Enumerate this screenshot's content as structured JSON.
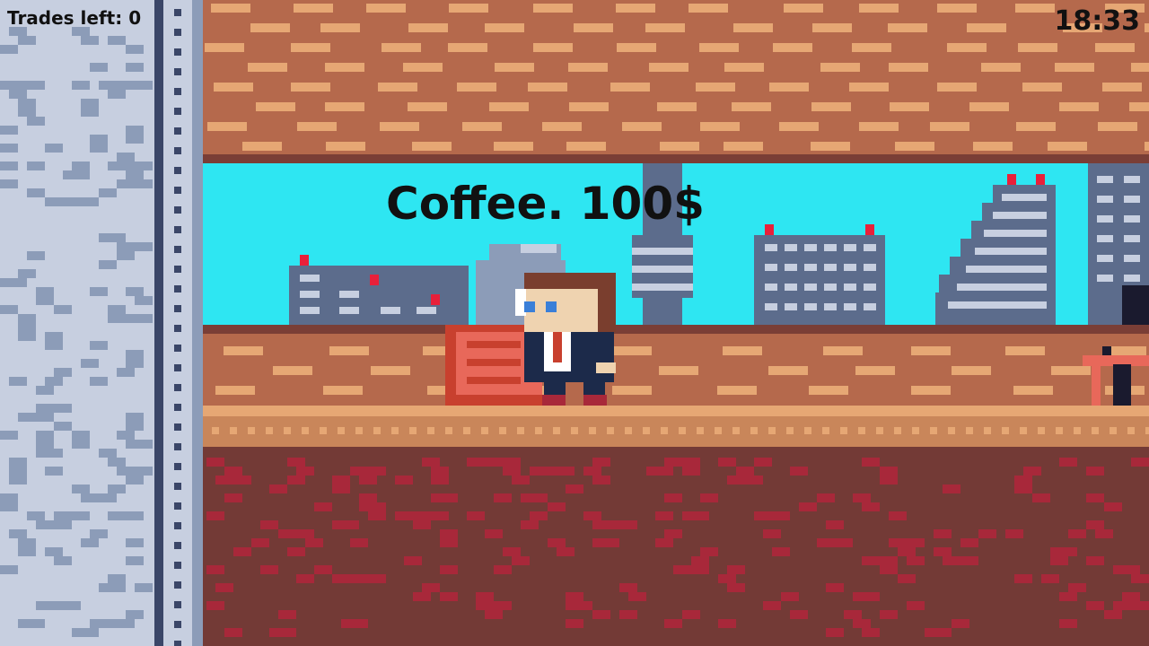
{
  "hud": {
    "trades_left": "Trades left: 0",
    "clock": "18:33"
  },
  "shop": {
    "price_label": "Coffee. 100$"
  },
  "colors": {
    "ceiling": "#b5694c",
    "ceiling_brick": "#e6a774",
    "sky": "#2ee6f2",
    "building": "#5c6c8c",
    "building_window": "#c7cfe0",
    "floor": "#e6a774",
    "ground": "#733a36",
    "ground_speck": "#a8283a",
    "wall_left": "#c7cfe0",
    "wall_speck": "#8c9cb8",
    "wall_strip": "#3a4668",
    "coffee_machine": "#e8685a",
    "suit": "#1c2a4a",
    "tie": "#c8402e",
    "hair": "#7a3e2e",
    "skin": "#efd3b0"
  }
}
